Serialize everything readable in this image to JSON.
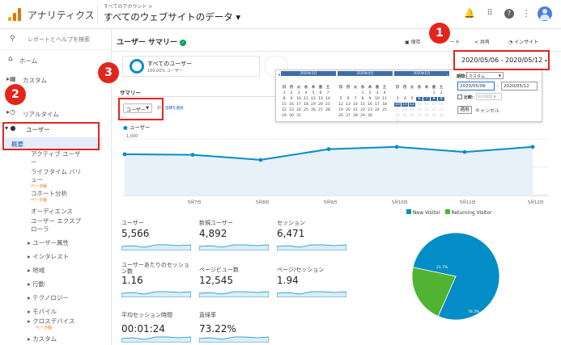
{
  "header": {
    "app_title": "アナリティクス",
    "account_crumb": "すべてのアカウント >",
    "property_name": "すべてのウェブサイトのデータ ▾",
    "icons": [
      "bell-icon",
      "apps-icon",
      "help-icon",
      "more-icon",
      "account-avatar"
    ]
  },
  "sidebar": {
    "search_placeholder": "レポートとヘルプを検索",
    "home": "ホーム",
    "custom": "カスタム",
    "realtime": "リアルタイム",
    "user": "ユーザー",
    "overview": "概要",
    "active_users": "アクティブ ユーザ",
    "active_users_2": "ー",
    "lifetime": "ライフタイム バリ",
    "lifetime_2": "ュー",
    "beta": "ベータ版",
    "cohort": "コホート分析",
    "audience": "オーディエンス",
    "explorer": "ユーザー エクスプ",
    "explorer_2": "ローラ",
    "attributes": "▸ ユーザー属性",
    "interests": "▸ インタレスト",
    "geo": "▸ 地域",
    "behavior": "▸ 行動",
    "technology": "▸ テクノロジー",
    "mobile": "▸ モバイル",
    "crossdevice": "▸ クロスデバイス",
    "custom2": "▸ カスタム"
  },
  "report": {
    "title": "ユーザー サマリー",
    "save": "保存",
    "export": "ート",
    "share": "共有",
    "insight": "インサイト",
    "segment_name": "すべてのユーザー",
    "segment_sub": "100.00% ユーザー",
    "summary_tab": "サマリー",
    "metric_select": "ユーザー",
    "vs": "対",
    "select_metric": "指標を選択",
    "legend": "ユーザー",
    "date_range": "2020/05/06 - 2020/05/12"
  },
  "date_picker": {
    "period_label": "期間:",
    "period_value": "カスタム",
    "start": "2020/05/06",
    "end": "2020/05/12",
    "compare": "比較:",
    "compare_value": "前の期間",
    "apply": "適用",
    "cancel": "キャンセル",
    "months": [
      "2020年3月",
      "2020年4月",
      "2020年5月"
    ],
    "weekdays": [
      "日",
      "月",
      "火",
      "水",
      "木",
      "金",
      "土"
    ]
  },
  "chart_data": {
    "type": "line",
    "categories": [
      "",
      "5月7日",
      "5月8日",
      "5月9日",
      "5月10日",
      "5月11日",
      "5月12日"
    ],
    "series": [
      {
        "name": "ユーザー",
        "values": [
          730,
          720,
          630,
          820,
          860,
          770,
          860
        ]
      }
    ],
    "ylim": [
      0,
      1000
    ],
    "yticks": [
      "1,000",
      "500"
    ],
    "color": "#058dc7"
  },
  "metrics": [
    {
      "label": "ユーザー",
      "value": "5,566"
    },
    {
      "label": "新規ユーザー",
      "value": "4,892"
    },
    {
      "label": "セッション",
      "value": "6,471"
    },
    {
      "label": "ユーザーあたりのセッション数",
      "value": "1.16"
    },
    {
      "label": "ページビュー数",
      "value": "12,545"
    },
    {
      "label": "ページ/セッション",
      "value": "1.94"
    },
    {
      "label": "平均セッション時間",
      "value": "00:01:24"
    },
    {
      "label": "直帰率",
      "value": "73.22%"
    }
  ],
  "pie": {
    "legend": [
      {
        "label": "New Visitor",
        "color": "#058dc7",
        "value": 78.3
      },
      {
        "label": "Returning Visitor",
        "color": "#50b432",
        "value": 21.7
      }
    ],
    "labels": [
      "78.3%",
      "21.7%"
    ]
  },
  "callouts": [
    "1",
    "2",
    "3"
  ]
}
